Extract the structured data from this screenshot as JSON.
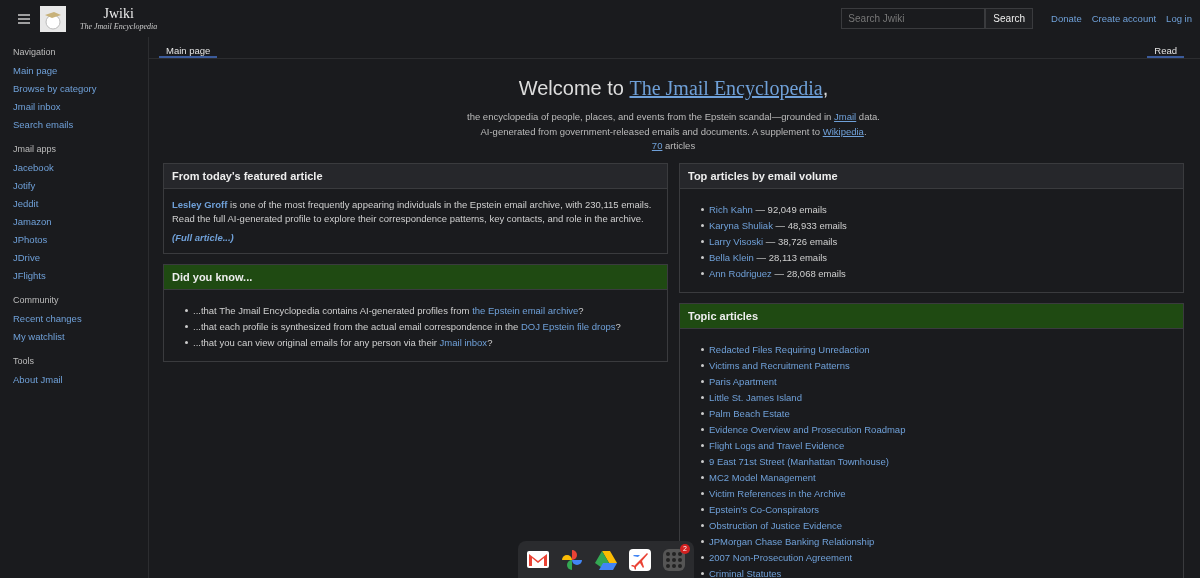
{
  "header": {
    "site_name": "Jwiki",
    "tagline": "The Jmail Encyclopedia",
    "search": {
      "placeholder": "Search Jwiki",
      "button": "Search"
    },
    "links": [
      "Donate",
      "Create account",
      "Log in"
    ]
  },
  "sidebar": {
    "sections": [
      {
        "heading": "Navigation",
        "items": [
          "Main page",
          "Browse by category",
          "Jmail inbox",
          "Search emails"
        ]
      },
      {
        "heading": "Jmail apps",
        "items": [
          "Jacebook",
          "Jotify",
          "Jeddit",
          "Jamazon",
          "JPhotos",
          "JDrive",
          "JFlights"
        ]
      },
      {
        "heading": "Community",
        "items": [
          "Recent changes",
          "My watchlist"
        ]
      },
      {
        "heading": "Tools",
        "items": [
          "About Jmail"
        ]
      }
    ]
  },
  "tabs": [
    {
      "label": "Main page",
      "selected": true
    },
    {
      "label": "Read",
      "selected": true
    }
  ],
  "welcome": {
    "before": "Welcome to ",
    "link": "The Jmail Encyclopedia",
    "after": ",",
    "lines": [
      {
        "before": "the encyclopedia of people, places, and events from the Epstein scandal—grounded in ",
        "link": "Jmail",
        "after": " data."
      },
      {
        "before": "AI-generated from government-released emails and documents. A supplement to ",
        "link": "Wikipedia",
        "after": "."
      },
      {
        "link": "70",
        "after": " articles"
      }
    ]
  },
  "featured": {
    "title": "From today's featured article",
    "link": "Lesley Groff",
    "text": " is one of the most frequently appearing individuals in the Epstein email archive, with 230,115 emails. Read the full AI-generated profile to explore their correspondence patterns, key contacts, and role in the archive.",
    "more": "(Full article...)"
  },
  "did_you_know": {
    "title": "Did you know...",
    "items": [
      {
        "before": "...that The Jmail Encyclopedia contains AI-generated profiles from ",
        "link": "the Epstein email archive",
        "after": "?"
      },
      {
        "before": "...that each profile is synthesized from the actual email correspondence in the ",
        "link": "DOJ Epstein file drops",
        "after": "?"
      },
      {
        "before": "...that you can view original emails for any person via their ",
        "link": "Jmail inbox",
        "after": "?"
      }
    ]
  },
  "top_articles": {
    "title": "Top articles by email volume",
    "items": [
      {
        "name": "Rich Kahn",
        "count": " — 92,049 emails"
      },
      {
        "name": "Karyna Shuliak",
        "count": " — 48,933 emails"
      },
      {
        "name": "Larry Visoski",
        "count": " — 38,726 emails"
      },
      {
        "name": "Bella Klein",
        "count": " — 28,113 emails"
      },
      {
        "name": "Ann Rodriguez",
        "count": " — 28,068 emails"
      }
    ]
  },
  "topic_articles": {
    "title": "Topic articles",
    "items": [
      "Redacted Files Requiring Unredaction",
      "Victims and Recruitment Patterns",
      "Paris Apartment",
      "Little St. James Island",
      "Palm Beach Estate",
      "Evidence Overview and Prosecution Roadmap",
      "Flight Logs and Travel Evidence",
      "9 East 71st Street (Manhattan Townhouse)",
      "MC2 Model Management",
      "Victim References in the Archive",
      "Epstein's Co-Conspirators",
      "Obstruction of Justice Evidence",
      "JPMorgan Chase Banking Relationship",
      "2007 Non-Prosecution Agreement",
      "Criminal Statutes"
    ]
  },
  "dock": {
    "apps": [
      {
        "kind": "mail"
      },
      {
        "kind": "photos"
      },
      {
        "kind": "drive"
      },
      {
        "kind": "flights"
      },
      {
        "kind": "grid",
        "badge": "2"
      }
    ]
  }
}
